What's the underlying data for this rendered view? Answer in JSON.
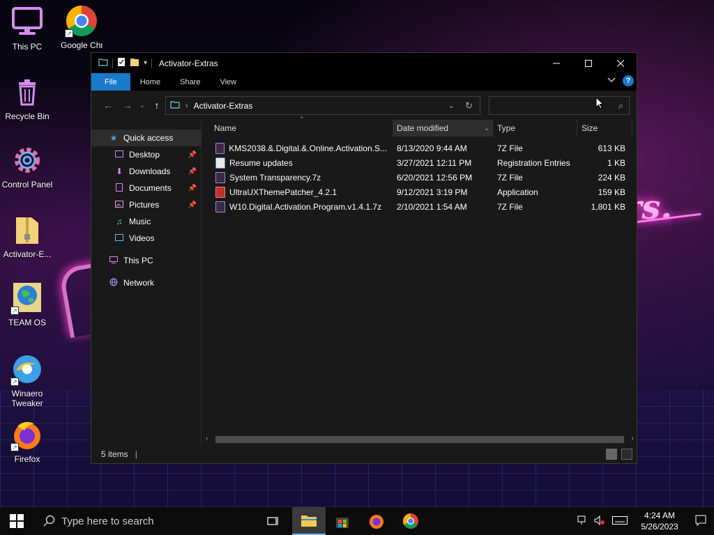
{
  "desktop": {
    "wallpaper_text": "ers.",
    "icons": [
      {
        "label": "This PC"
      },
      {
        "label": "Google Chrom"
      },
      {
        "label": "Recycle Bin"
      },
      {
        "label": "Control Panel"
      },
      {
        "label": "Activator-E..."
      },
      {
        "label": "TEAM OS"
      },
      {
        "label": "Winaero Tweaker"
      },
      {
        "label": "Firefox"
      }
    ]
  },
  "window": {
    "title": "Activator-Extras",
    "ribbon_tabs": [
      "File",
      "Home",
      "Share",
      "View"
    ],
    "help": "?",
    "address": {
      "crumb": "Activator-Extras"
    },
    "search": {
      "placeholder": "",
      "value": ""
    },
    "nav": [
      {
        "label": "Quick access",
        "icon": "star-icon",
        "pinned": false
      },
      {
        "label": "Desktop",
        "icon": "desktop-icon",
        "pinned": true
      },
      {
        "label": "Downloads",
        "icon": "download-icon",
        "pinned": true
      },
      {
        "label": "Documents",
        "icon": "documents-icon",
        "pinned": true
      },
      {
        "label": "Pictures",
        "icon": "pictures-icon",
        "pinned": true
      },
      {
        "label": "Music",
        "icon": "music-icon",
        "pinned": false
      },
      {
        "label": "Videos",
        "icon": "videos-icon",
        "pinned": false
      },
      {
        "label": "This PC",
        "icon": "computer-icon",
        "pinned": false
      },
      {
        "label": "Network",
        "icon": "network-icon",
        "pinned": false
      }
    ],
    "columns": {
      "name": "Name",
      "date": "Date modified",
      "type": "Type",
      "size": "Size"
    },
    "files": [
      {
        "name": "KMS2038.&.Digital.&.Online.Activation.S...",
        "date": "8/13/2020 9:44 AM",
        "type": "7Z File",
        "size": "613 KB",
        "icon": "archive-icon"
      },
      {
        "name": "Resume updates",
        "date": "3/27/2021 12:11 PM",
        "type": "Registration Entries",
        "size": "1 KB",
        "icon": "registry-icon"
      },
      {
        "name": "System Transparency.7z",
        "date": "6/20/2021 12:56 PM",
        "type": "7Z File",
        "size": "224 KB",
        "icon": "archive-icon"
      },
      {
        "name": "UltraUXThemePatcher_4.2.1",
        "date": "9/12/2021 3:19 PM",
        "type": "Application",
        "size": "159 KB",
        "icon": "application-icon"
      },
      {
        "name": "W10.Digital.Activation.Program.v1.4.1.7z",
        "date": "2/10/2021 1:54 AM",
        "type": "7Z File",
        "size": "1,801 KB",
        "icon": "archive-icon"
      }
    ],
    "status": {
      "items": "5 items"
    }
  },
  "taskbar": {
    "search_placeholder": "Type here to search",
    "time": "4:24 AM",
    "date": "5/26/2023"
  },
  "colors": {
    "accent": "#1979ca",
    "window_bg": "#191919",
    "titlebar_bg": "#000000"
  }
}
